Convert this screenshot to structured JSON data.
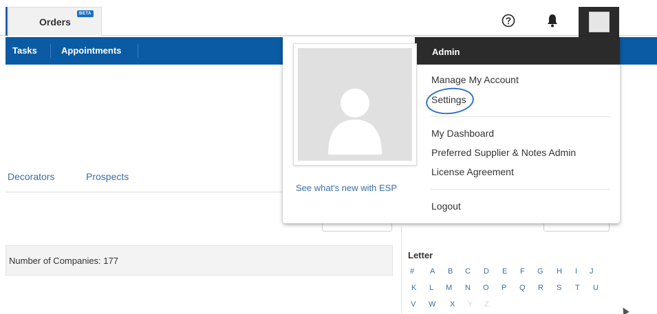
{
  "topbar": {
    "orders_tab": "Orders",
    "beta_badge": "BETA",
    "icons": {
      "help": "help-circle-icon",
      "notifications": "bell-icon",
      "user": "user-avatar-icon"
    }
  },
  "nav": {
    "items": [
      "Tasks",
      "Appointments"
    ]
  },
  "subtabs": [
    "Decorators",
    "Prospects"
  ],
  "summary": {
    "companies_count": "Number of Companies: 177"
  },
  "letter_filter": {
    "title": "Letter",
    "rows": [
      [
        "#",
        "A",
        "B",
        "C",
        "D",
        "E",
        "F",
        "G",
        "H",
        "I",
        "J"
      ],
      [
        "K",
        "L",
        "M",
        "N",
        "O",
        "P",
        "Q",
        "R",
        "S",
        "T",
        "U"
      ],
      [
        "V",
        "W",
        "X",
        "Y",
        "Z"
      ]
    ],
    "disabled": [
      "Y",
      "Z"
    ]
  },
  "user_menu": {
    "header": "Admin",
    "whats_new": "See what's new with ESP",
    "group1": [
      "Manage My Account",
      "Settings"
    ],
    "group2": [
      "My Dashboard",
      "Preferred Supplier & Notes Admin",
      "License Agreement"
    ],
    "logout": "Logout"
  },
  "colors": {
    "nav_blue": "#0b5ba4",
    "dark_header": "#2b2b2b",
    "link_blue": "#3a6ea5",
    "annotation_circle": "#3574c4"
  }
}
